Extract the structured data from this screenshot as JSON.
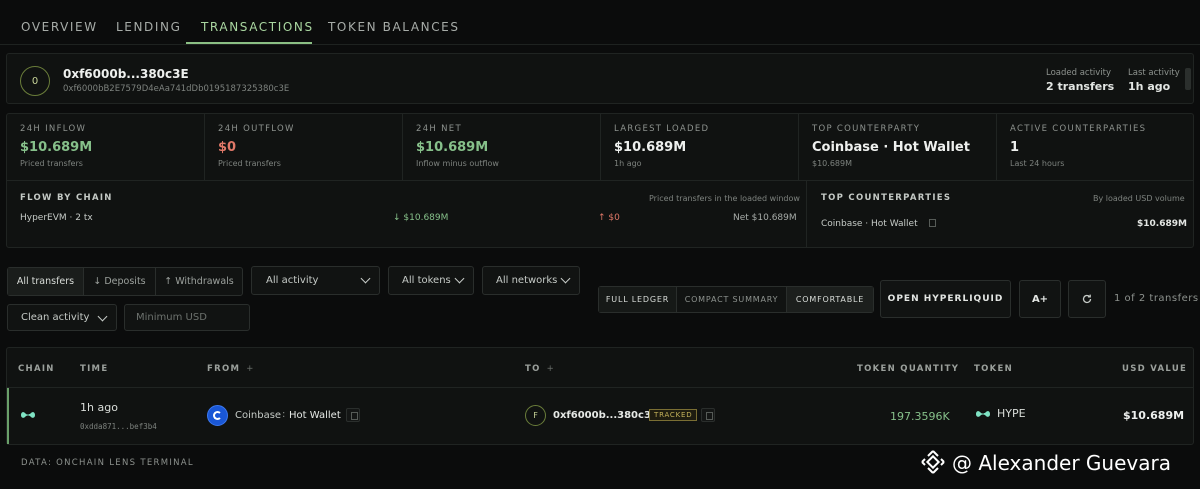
{
  "tabs": [
    {
      "label": "OVERVIEW"
    },
    {
      "label": "LENDING"
    },
    {
      "label": "TRANSACTIONS",
      "active": true
    },
    {
      "label": "TOKEN BALANCES"
    }
  ],
  "address": {
    "avatar_letter": "0",
    "short": "0xf6000b...380c3E",
    "full": "0xf6000bB2E7579D4eAa741dDb0195187325380c3E",
    "loaded_activity_label": "Loaded activity",
    "loaded_activity_value": "2 transfers",
    "last_activity_label": "Last activity",
    "last_activity_value": "1h ago"
  },
  "metrics": [
    {
      "title": "24H INFLOW",
      "value": "$10.689M",
      "sub": "Priced transfers",
      "tone": "green"
    },
    {
      "title": "24H OUTFLOW",
      "value": "$0",
      "sub": "Priced transfers",
      "tone": "red"
    },
    {
      "title": "24H NET",
      "value": "$10.689M",
      "sub": "Inflow minus outflow",
      "tone": "green"
    },
    {
      "title": "LARGEST LOADED",
      "value": "$10.689M",
      "sub": "1h ago",
      "tone": "white"
    },
    {
      "title": "TOP COUNTERPARTY",
      "value": "Coinbase · Hot Wallet",
      "sub": "$10.689M",
      "tone": "white"
    },
    {
      "title": "ACTIVE COUNTERPARTIES",
      "value": "1",
      "sub": "Last 24 hours",
      "tone": "white"
    }
  ],
  "flow_by_chain": {
    "title": "FLOW BY CHAIN",
    "note": "Priced transfers in the loaded window",
    "rows": [
      {
        "chain": "HyperEVM · 2 tx",
        "inflow": "↓ $10.689M",
        "outflow": "↑ $0",
        "net": "Net $10.689M"
      }
    ]
  },
  "top_counterparties": {
    "title": "TOP COUNTERPARTIES",
    "note": "By loaded USD volume",
    "rows": [
      {
        "name": "Coinbase · Hot Wallet",
        "value": "$10.689M"
      }
    ]
  },
  "filters": {
    "direction": [
      "All transfers",
      "↓ Deposits",
      "↑ Withdrawals"
    ],
    "activity": "All activity",
    "tokens": "All tokens",
    "networks": "All networks",
    "clean": "Clean activity",
    "min_usd_placeholder": "Minimum USD",
    "ledger_modes": [
      "FULL LEDGER",
      "COMPACT SUMMARY",
      "COMFORTABLE"
    ],
    "open_button": "OPEN HYPERLIQUID",
    "font_button": "A+",
    "refresh_icon": "refresh-icon",
    "count_text": "1 of 2 transfers"
  },
  "table": {
    "headers": {
      "chain": "CHAIN",
      "time": "TIME",
      "from": "FROM",
      "to": "TO",
      "qty": "TOKEN QUANTITY",
      "token": "TOKEN",
      "usd": "USD VALUE"
    },
    "rows": [
      {
        "chain_icon": "hyperevm-icon",
        "time": "1h ago",
        "hash": "0xdda871...bef3b4",
        "from_entity": "Coinbase",
        "from_label": "Hot Wallet",
        "to_avatar": "F",
        "to_address": "0xf6000b...380c3E",
        "to_badge": "TRACKED",
        "quantity": "197.3596K",
        "token": "HYPE",
        "usd": "$10.689M"
      }
    ]
  },
  "footer": {
    "source": "DATA: ONCHAIN LENS TERMINAL",
    "watermark": "@ Alexander Guevara"
  },
  "colors": {
    "accent_green": "#86c08a",
    "negative_red": "#e07868",
    "tracked_badge": "#c4b25a",
    "background": "#0b0c0c"
  }
}
